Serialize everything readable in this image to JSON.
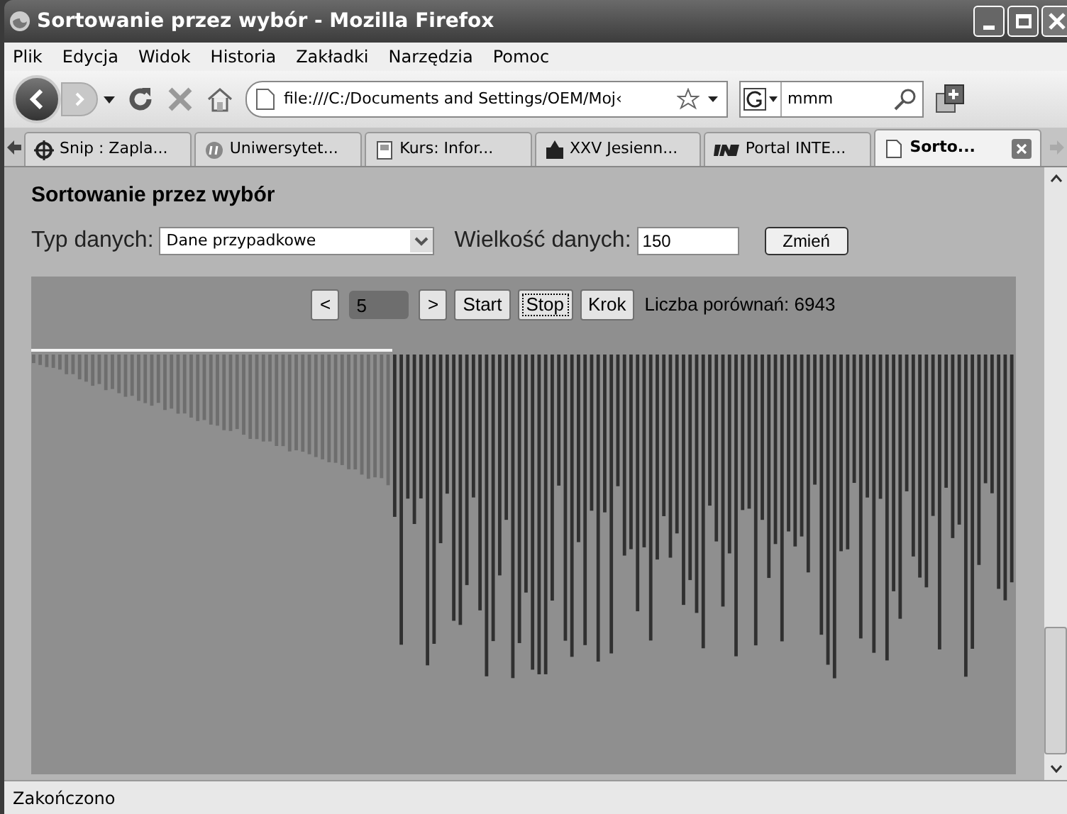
{
  "window": {
    "title": "Sortowanie przez wybór - Mozilla Firefox"
  },
  "menu": [
    "Plik",
    "Edycja",
    "Widok",
    "Historia",
    "Zakładki",
    "Narzędzia",
    "Pomoc"
  ],
  "toolbar": {
    "url": "file:///C:/Documents and Settings/OEM/Moj‹",
    "search": "mmm"
  },
  "tabs": [
    {
      "label": "Snip : Zapla...",
      "selected": false
    },
    {
      "label": "Uniwersytet...",
      "selected": false
    },
    {
      "label": "Kurs: Infor...",
      "selected": false
    },
    {
      "label": "XXV Jesienn...",
      "selected": false
    },
    {
      "label": "Portal INTE...",
      "selected": false
    },
    {
      "label": "Sorto...",
      "selected": true
    }
  ],
  "page": {
    "heading": "Sortowanie przez wybór",
    "type_label": "Typ danych:",
    "type_value": "Dane przypadkowe",
    "size_label": "Wielkość danych:",
    "size_value": "150",
    "change_button": "Zmień",
    "controls": {
      "prev": "<",
      "speed": "5",
      "next": ">",
      "start": "Start",
      "stop": "Stop",
      "step": "Krok",
      "comparisons": "Liczba porównań: 6943"
    }
  },
  "status_bar": "Zakończono"
}
